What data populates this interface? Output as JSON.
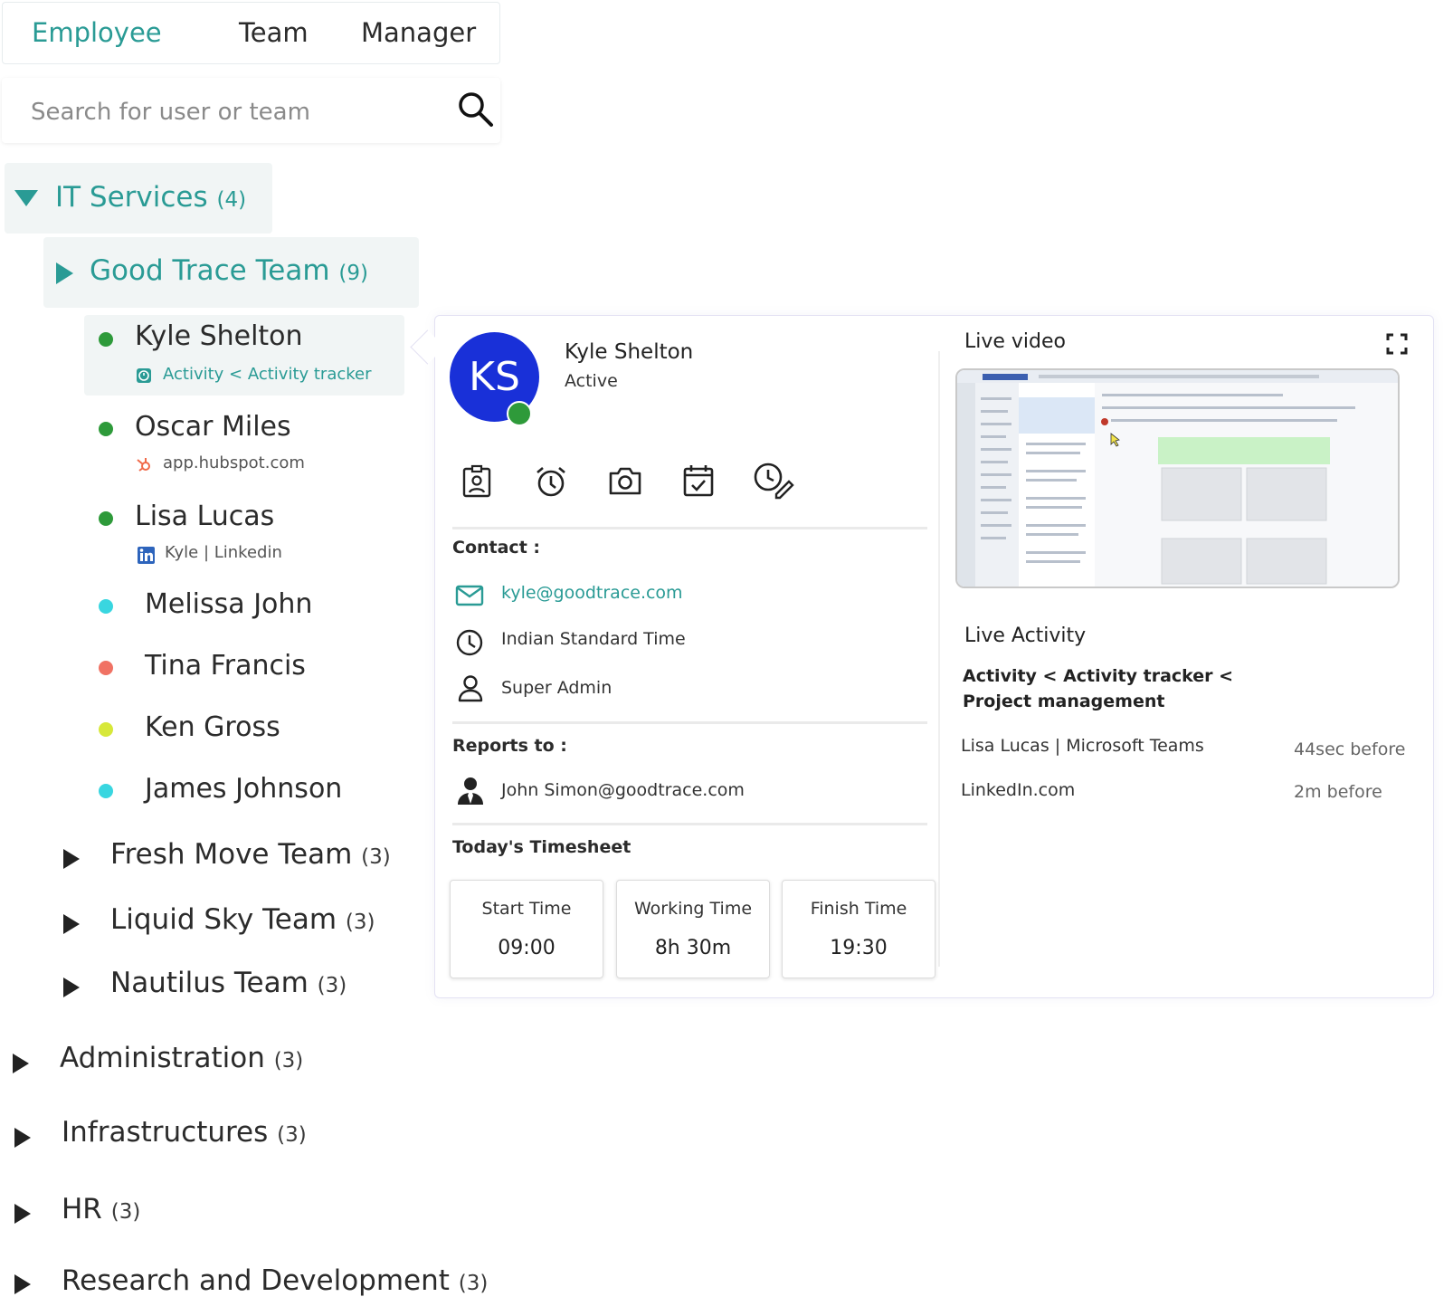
{
  "tabs": [
    {
      "label": "Employee",
      "active": true
    },
    {
      "label": "Team",
      "active": false
    },
    {
      "label": "Manager",
      "active": false
    }
  ],
  "search": {
    "placeholder": "Search for user or team"
  },
  "tree": {
    "group": {
      "name": "IT Services",
      "count": "(4)"
    },
    "team": {
      "name": "Good Trace Team",
      "count": "(9)"
    },
    "members": [
      {
        "name": "Kyle Shelton",
        "status_color": "#2e9a3a",
        "sub": "Activity < Activity tracker",
        "sub_icon": "activity-tracker-icon"
      },
      {
        "name": "Oscar Miles",
        "status_color": "#2e9a3a",
        "sub": "app.hubspot.com",
        "sub_icon": "hubspot-icon"
      },
      {
        "name": "Lisa Lucas",
        "status_color": "#2e9a3a",
        "sub": "Kyle | Linkedin",
        "sub_icon": "linkedin-icon"
      },
      {
        "name": "Melissa John",
        "status_color": "#39d6e0"
      },
      {
        "name": "Tina Francis",
        "status_color": "#f07264"
      },
      {
        "name": "Ken Gross",
        "status_color": "#d7e83a"
      },
      {
        "name": "James Johnson",
        "status_color": "#39d6e0"
      }
    ],
    "other_teams": [
      {
        "name": "Fresh Move Team",
        "count": "(3)"
      },
      {
        "name": "Liquid Sky Team",
        "count": "(3)"
      },
      {
        "name": "Nautilus Team",
        "count": "(3)"
      }
    ],
    "other_groups": [
      {
        "name": "Administration",
        "count": "(3)"
      },
      {
        "name": "Infrastructures",
        "count": "(3)"
      },
      {
        "name": "HR",
        "count": "(3)"
      },
      {
        "name": "Research and Development",
        "count": "(3)"
      }
    ]
  },
  "profile": {
    "initials": "KS",
    "name": "Kyle Shelton",
    "status": "Active",
    "contact_title": "Contact :",
    "email": "kyle@goodtrace.com",
    "timezone": "Indian Standard Time",
    "role": "Super Admin",
    "reports_title": "Reports to :",
    "reports_to": "John Simon@goodtrace.com",
    "timesheet_title": "Today's Timesheet",
    "timesheet": [
      {
        "label": "Start Time",
        "value": "09:00"
      },
      {
        "label": "Working Time",
        "value": "8h 30m"
      },
      {
        "label": "Finish Time",
        "value": "19:30"
      }
    ]
  },
  "live": {
    "video_title": "Live video",
    "activity_title": "Live Activity",
    "activity_path": "Activity < Activity tracker < Project management",
    "entries": [
      {
        "text": "Lisa Lucas | Microsoft Teams",
        "time": "44sec before"
      },
      {
        "text": "LinkedIn.com",
        "time": "2m before"
      }
    ]
  },
  "colors": {
    "accent": "#2a9b95",
    "avatar": "#1930d8",
    "online": "#2e9a3a"
  }
}
